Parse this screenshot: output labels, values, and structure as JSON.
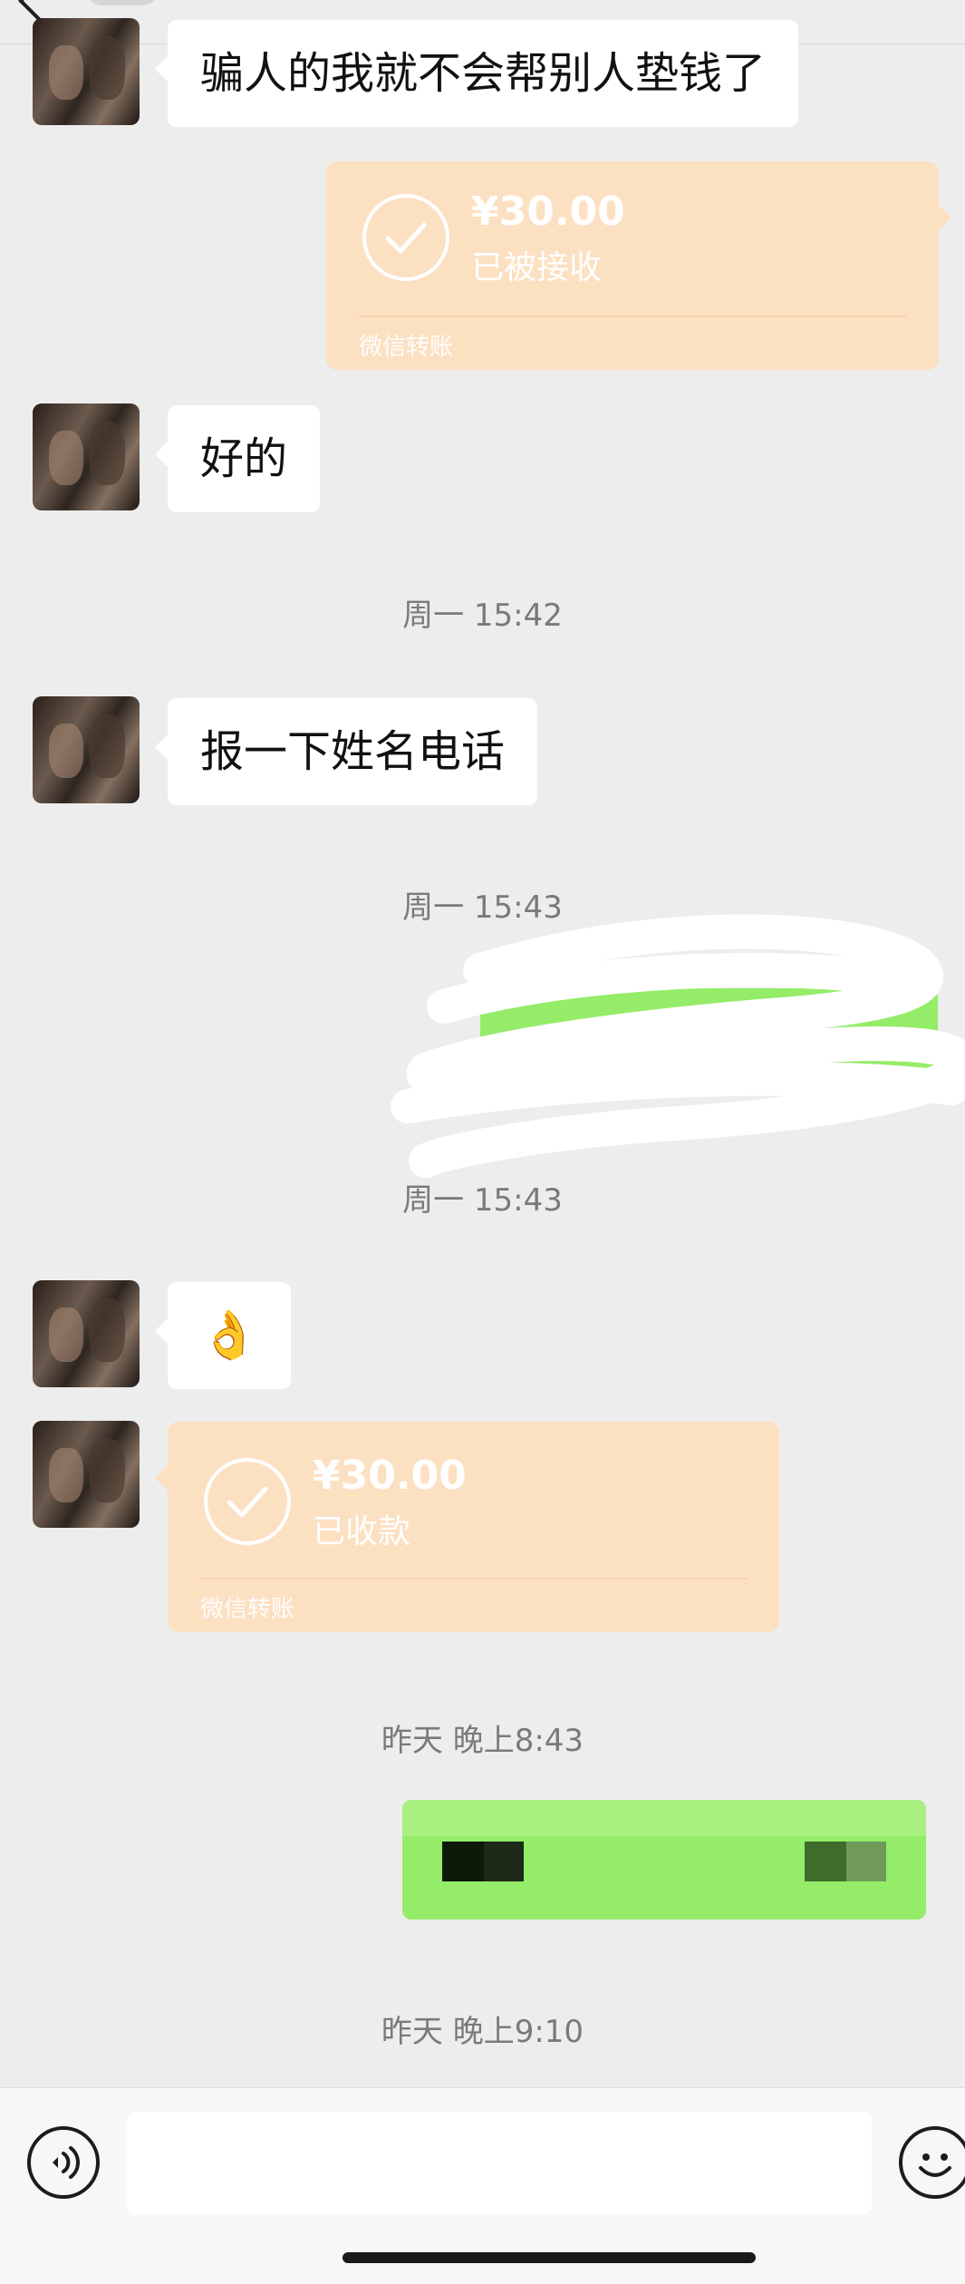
{
  "chat": {
    "messages": {
      "m1_text": "骗人的我就不会帮别人垫钱了",
      "transfer1": {
        "amount": "¥30.00",
        "status": "已被接收",
        "label": "微信转账"
      },
      "m2_text": "好的",
      "ts1": "周一 15:42",
      "m3_text": "报一下姓名电话",
      "ts2": "周一 15:43",
      "ts3": "周一 15:43",
      "m5_emoji": "👌",
      "transfer2": {
        "amount": "¥30.00",
        "status": "已收款",
        "label": "微信转账"
      },
      "ts4": "昨天 晚上8:43",
      "ts5": "昨天 晚上9:10"
    }
  },
  "input_bar": {
    "input_value": "",
    "placeholder": ""
  },
  "colors": {
    "background": "#ededed",
    "incoming_bubble": "#ffffff",
    "outgoing_bubble": "#95ec69",
    "transfer_card": "#fce0c2",
    "timestamp_text": "#7a7a7a"
  },
  "icons": {
    "back": "chevron-left-icon",
    "voice": "voice-icon",
    "emoji": "emoji-icon",
    "transfer_check": "check-circle-icon"
  }
}
